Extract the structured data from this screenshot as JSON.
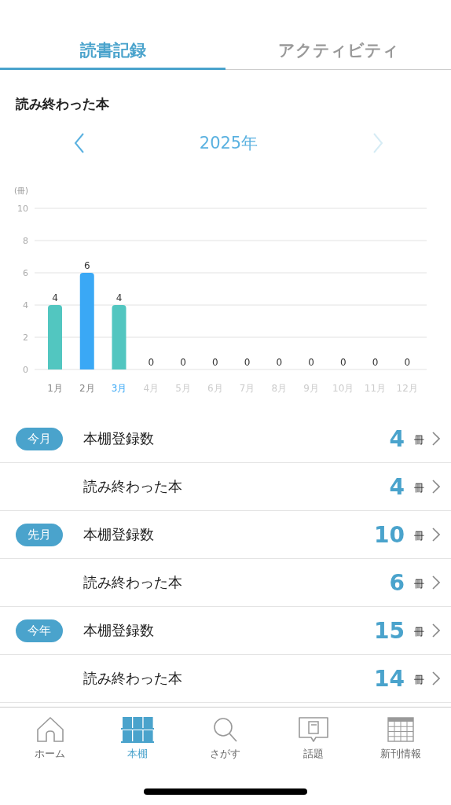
{
  "tabs": [
    {
      "label": "読書記録",
      "selected": true
    },
    {
      "label": "アクティビティ",
      "selected": false
    }
  ],
  "section_title": "読み終わった本",
  "year_nav": {
    "label": "2025年",
    "prev_disabled": false,
    "next_disabled": true
  },
  "chart": {
    "unit_label": "(冊)",
    "month_labels": [
      {
        "selected": false,
        "disabled": false
      },
      {
        "selected": false,
        "disabled": false
      },
      {
        "selected": true,
        "disabled": false
      },
      {
        "selected": false,
        "disabled": true
      },
      {
        "selected": false,
        "disabled": true
      },
      {
        "selected": false,
        "disabled": true
      },
      {
        "selected": false,
        "disabled": true
      },
      {
        "selected": false,
        "disabled": true
      },
      {
        "selected": false,
        "disabled": true
      },
      {
        "selected": false,
        "disabled": true
      },
      {
        "selected": false,
        "disabled": true
      },
      {
        "selected": false,
        "disabled": true
      }
    ],
    "chart_data": {
      "type": "bar",
      "categories": [
        "1月",
        "2月",
        "3月",
        "4月",
        "5月",
        "6月",
        "7月",
        "8月",
        "9月",
        "10月",
        "11月",
        "12月"
      ],
      "series": [
        {
          "color": "#52c6c0",
          "values": [
            4,
            null,
            4,
            0,
            0,
            0,
            0,
            0,
            0,
            0,
            0,
            0
          ]
        },
        {
          "color": "#3aa8f5",
          "values": [
            null,
            6,
            null,
            null,
            null,
            null,
            null,
            null,
            null,
            null,
            null,
            null
          ]
        }
      ],
      "grid": true,
      "ylim": [
        0,
        10
      ],
      "yticks": [
        0,
        2,
        4,
        6,
        8,
        10
      ],
      "data_labels": true
    }
  },
  "stats": [
    {
      "badge": "今月",
      "label": "本棚登録数",
      "value": "4",
      "unit": "冊"
    },
    {
      "label": "読み終わった本",
      "value": "4",
      "unit": "冊"
    },
    {
      "badge": "先月",
      "label": "本棚登録数",
      "value": "10",
      "unit": "冊"
    },
    {
      "label": "読み終わった本",
      "value": "6",
      "unit": "冊"
    },
    {
      "badge": "今年",
      "label": "本棚登録数",
      "value": "15",
      "unit": "冊"
    },
    {
      "label": "読み終わった本",
      "value": "14",
      "unit": "冊"
    }
  ],
  "tab_bar": [
    {
      "kind": "home",
      "label": "ホーム",
      "selected": false
    },
    {
      "kind": "shelf",
      "label": "本棚",
      "selected": true
    },
    {
      "kind": "search",
      "label": "さがす",
      "selected": false
    },
    {
      "kind": "topic",
      "label": "話題",
      "selected": false
    },
    {
      "kind": "calendar",
      "label": "新刊情報",
      "selected": false
    }
  ]
}
